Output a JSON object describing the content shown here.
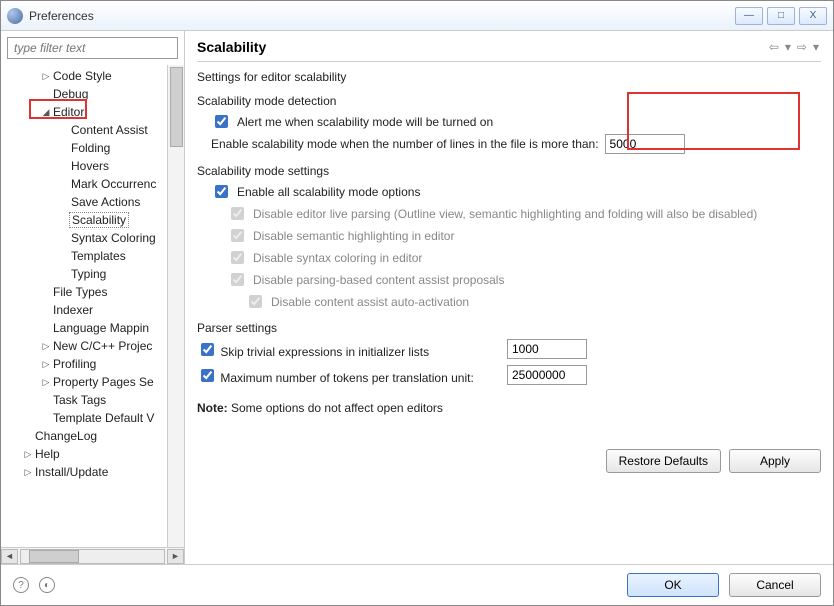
{
  "window": {
    "title": "Preferences",
    "min": "—",
    "max": "□",
    "close": "X"
  },
  "filter": {
    "placeholder": "type filter text"
  },
  "tree": {
    "codeStyle": "Code Style",
    "debug": "Debug",
    "editor": "Editor",
    "contentAssist": "Content Assist",
    "folding": "Folding",
    "hovers": "Hovers",
    "markOccur": "Mark Occurrenc",
    "saveActions": "Save Actions",
    "scalability": "Scalability",
    "syntaxColoring": "Syntax Coloring",
    "templates": "Templates",
    "typing": "Typing",
    "fileTypes": "File Types",
    "indexer": "Indexer",
    "langMapping": "Language Mappin",
    "newProj": "New C/C++ Projec",
    "profiling": "Profiling",
    "propPages": "Property Pages Se",
    "taskTags": "Task Tags",
    "templateDef": "Template Default V",
    "changeLog": "ChangeLog",
    "help": "Help",
    "installUpdate": "Install/Update"
  },
  "page": {
    "title": "Scalability",
    "subtitle": "Settings for editor scalability",
    "detection": {
      "title": "Scalability mode detection",
      "alert": "Alert me when scalability mode will be turned on",
      "enableLabel": "Enable scalability mode when the number of lines in the file is more than:",
      "enableValue": "5000"
    },
    "settings": {
      "title": "Scalability mode settings",
      "enableAll": "Enable all scalability mode options",
      "disableLive": "Disable editor live parsing (Outline view, semantic highlighting and folding will also be disabled)",
      "disableSemantic": "Disable semantic highlighting in editor",
      "disableSyntax": "Disable syntax coloring in editor",
      "disableParsing": "Disable parsing-based content assist proposals",
      "disableAuto": "Disable content assist auto-activation"
    },
    "parser": {
      "title": "Parser settings",
      "skipLabel": "Skip trivial expressions in initializer lists",
      "skipValue": "1000",
      "maxLabel": "Maximum number of tokens per translation unit:",
      "maxValue": "25000000"
    },
    "noteBold": "Note:",
    "noteText": " Some options do not affect open editors"
  },
  "buttons": {
    "restore": "Restore Defaults",
    "apply": "Apply",
    "ok": "OK",
    "cancel": "Cancel"
  },
  "nav": {
    "back": "⇦",
    "sep1": "▾",
    "fwd": "⇨",
    "sep2": "▾"
  }
}
